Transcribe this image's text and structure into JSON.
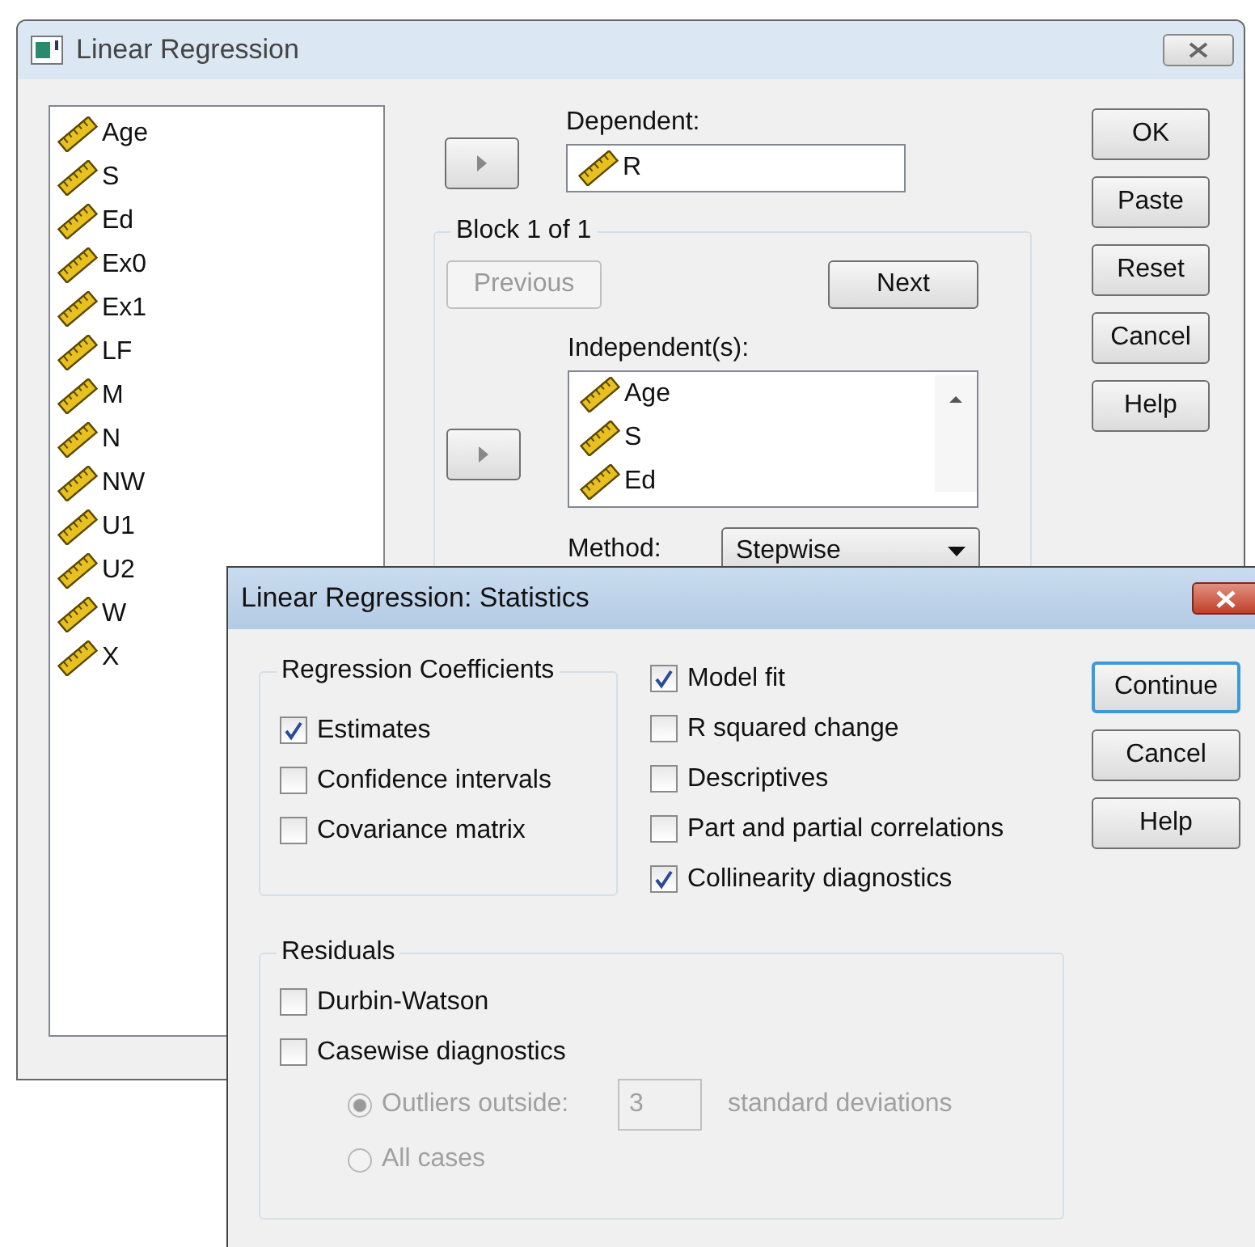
{
  "main_window": {
    "title": "Linear Regression",
    "variables": [
      "Age",
      "S",
      "Ed",
      "Ex0",
      "Ex1",
      "LF",
      "M",
      "N",
      "NW",
      "U1",
      "U2",
      "W",
      "X"
    ],
    "dependent": {
      "label": "Dependent:",
      "value": "R"
    },
    "block": {
      "title": "Block 1 of 1",
      "previous": {
        "label": "Previous",
        "disabled": true
      },
      "next": {
        "label": "Next",
        "disabled": false
      }
    },
    "independents": {
      "label": "Independent(s):",
      "items": [
        "Age",
        "S",
        "Ed"
      ]
    },
    "method": {
      "label": "Method:",
      "value": "Stepwise"
    },
    "buttons": [
      "OK",
      "Paste",
      "Reset",
      "Cancel",
      "Help"
    ]
  },
  "statistics_dialog": {
    "title": "Linear Regression: Statistics",
    "coefficients": {
      "title": "Regression Coefficients",
      "options": [
        {
          "label": "Estimates",
          "checked": true
        },
        {
          "label": "Confidence intervals",
          "checked": false
        },
        {
          "label": "Covariance matrix",
          "checked": false
        }
      ]
    },
    "options": [
      {
        "label": "Model fit",
        "checked": true
      },
      {
        "label": "R squared change",
        "checked": false
      },
      {
        "label": "Descriptives",
        "checked": false
      },
      {
        "label": "Part and partial correlations",
        "checked": false
      },
      {
        "label": "Collinearity diagnostics",
        "checked": true
      }
    ],
    "buttons": [
      {
        "label": "Continue",
        "default": true
      },
      {
        "label": "Cancel",
        "default": false
      },
      {
        "label": "Help",
        "default": false
      }
    ],
    "residuals": {
      "title": "Residuals",
      "options": [
        {
          "label": "Durbin-Watson",
          "checked": false
        },
        {
          "label": "Casewise diagnostics",
          "checked": false
        }
      ],
      "casewise": {
        "disabled": true,
        "items": [
          {
            "label": "Outliers outside:",
            "selected": true,
            "value": "3",
            "suffix": "standard deviations"
          },
          {
            "label": "All cases",
            "selected": false
          }
        ]
      }
    }
  }
}
